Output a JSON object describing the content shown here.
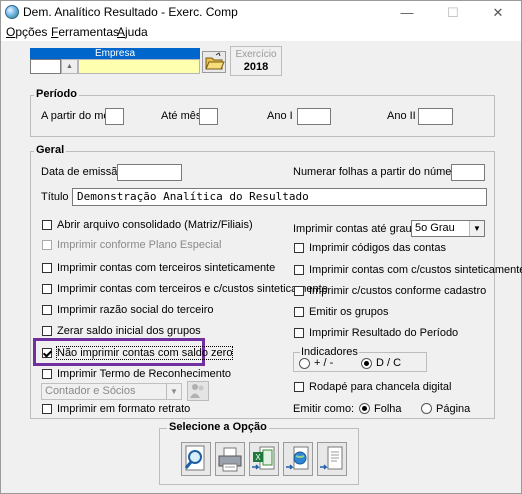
{
  "window": {
    "title": "Dem. Analítico Resultado - Exerc. Comp",
    "buttons": {
      "minimize": "—",
      "maximize": "☐",
      "close": "✕"
    }
  },
  "menu": [
    {
      "label": "Opções",
      "underline": "O",
      "rest": "pções"
    },
    {
      "label": "Ferramentas",
      "underline": "F",
      "rest": "erramentas"
    },
    {
      "label": "Ajuda",
      "underline": "A",
      "rest": "juda"
    }
  ],
  "empresa": {
    "label": "Empresa",
    "code": "",
    "name": ""
  },
  "exercicio": {
    "label": "Exercício",
    "value": "2018"
  },
  "periodo": {
    "title": "Período",
    "a_partir_label": "A partir do mês",
    "ate_label": "Até mês",
    "ano1_label": "Ano I",
    "ano2_label": "Ano II"
  },
  "geral": {
    "title": "Geral",
    "data_emissao_label": "Data de emissão",
    "numerar_label": "Numerar folhas a partir do número",
    "titulo_label": "Título",
    "titulo_value": "Demonstração Analítica do Resultado",
    "left_checks": [
      {
        "label": "Abrir arquivo consolidado (Matriz/Filiais)",
        "checked": false,
        "disabled": false
      },
      {
        "label": "Imprimir conforme Plano Especial",
        "checked": false,
        "disabled": true
      },
      {
        "label": "Imprimir contas com terceiros sinteticamente",
        "checked": false,
        "disabled": false
      },
      {
        "label": "Imprimir contas com terceiros e c/custos sinteticamente",
        "checked": false,
        "disabled": false
      },
      {
        "label": "Imprimir razão social do terceiro",
        "checked": false,
        "disabled": false
      },
      {
        "label": "Zerar saldo inicial dos grupos",
        "checked": false,
        "disabled": false
      },
      {
        "label": "Não imprimir contas com saldo zero",
        "checked": true,
        "disabled": false
      },
      {
        "label": "Imprimir Termo de Reconhecimento",
        "checked": false,
        "disabled": false
      }
    ],
    "termo_select": "Contador e Sócios",
    "retrato_label": "Imprimir em formato retrato",
    "imprimir_ate_label": "Imprimir contas até grau",
    "grau_value": "5o Grau",
    "right_checks": [
      {
        "label": "Imprimir códigos das contas",
        "checked": false
      },
      {
        "label": "Imprimir contas com c/custos sinteticamente",
        "checked": false
      },
      {
        "label": "Imprimir c/custos conforme cadastro",
        "checked": false
      },
      {
        "label": "Emitir os grupos",
        "checked": false
      },
      {
        "label": "Imprimir Resultado do Período",
        "checked": false
      }
    ],
    "indicadores": {
      "title": "Indicadores",
      "opt1": "+ / -",
      "opt2": "D / C",
      "selected": "D / C"
    },
    "rodape_label": "Rodapé para chancela digital",
    "emitir_como_label": "Emitir como:",
    "emitir_opt1": "Folha",
    "emitir_opt2": "Página",
    "emitir_selected": "Folha"
  },
  "selecione": {
    "title": "Selecione a Opção",
    "buttons": [
      "preview-icon",
      "printer-icon",
      "excel-export-icon",
      "web-export-icon",
      "document-export-icon"
    ]
  },
  "colors": {
    "empresa_header": "#0066cc",
    "empresa_field": "#ffffb0",
    "highlight": "#7030a0"
  }
}
